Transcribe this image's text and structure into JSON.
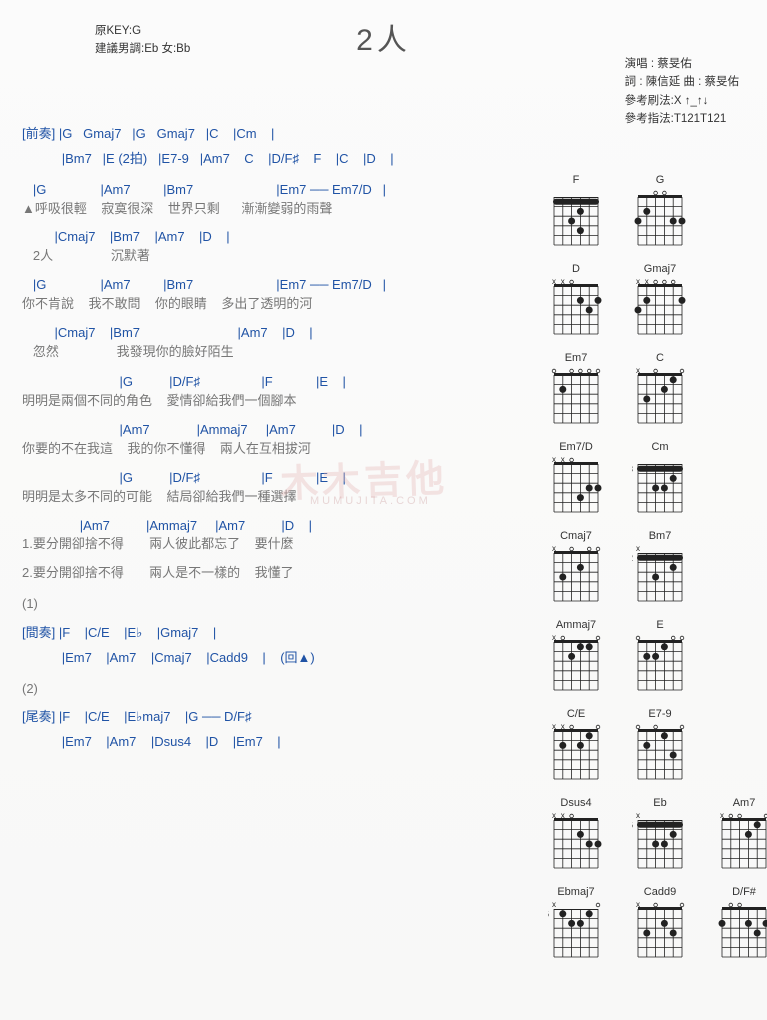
{
  "title": "2人",
  "meta_left": {
    "key_label": "原KEY:G",
    "suggest_label": "建議男調:Eb 女:Bb"
  },
  "meta_right": {
    "performer_label": "演唱 : ",
    "performer": "蔡旻佑",
    "lyricist_label": "詞 : ",
    "lyricist": "陳信延",
    "composer_label": "    曲 : ",
    "composer": "蔡旻佑",
    "strumming_label": "參考刷法:",
    "strumming": "X ↑_↑↓",
    "picking_label": "參考指法:",
    "picking": "T121T121"
  },
  "sections": {
    "intro": {
      "label": "[前奏]",
      "line1": "|G   Gmaj7   |G   Gmaj7   |C    |Cm    |",
      "line2": "|Bm7   |E (2拍)   |E7-9   |Am7    C    |D/F♯    F    |C    |D    |"
    },
    "verse1": {
      "c1": "   |G               |Am7         |Bm7                       |Em7 ── Em7/D   |",
      "l1": "▲呼吸很輕    寂寞很深    世界只剩      漸漸變弱的雨聲",
      "c2": "         |Cmaj7    |Bm7    |Am7    |D    |",
      "l2": "   2人                沉默著",
      "c3": "   |G               |Am7         |Bm7                       |Em7 ── Em7/D   |",
      "l3": "你不肯說    我不敢問    你的眼睛    多出了透明的河",
      "c4": "         |Cmaj7    |Bm7                           |Am7    |D    |",
      "l4": "   忽然                我發現你的臉好陌生"
    },
    "chorus": {
      "c1": "                           |G          |D/F♯                 |F            |E    |",
      "l1": "明明是兩個不同的角色    愛情卻給我們一個腳本",
      "c2": "                           |Am7             |Ammaj7     |Am7          |D    |",
      "l2": "你要的不在我這    我的你不懂得    兩人在互相拔河",
      "c3": "                           |G          |D/F♯                 |F            |E    |",
      "l3": "明明是太多不同的可能    結局卻給我們一種選擇",
      "c4": "                |Am7          |Ammaj7     |Am7          |D    |",
      "l4a": "1.要分開卻捨不得       兩人彼此都忘了    要什麼",
      "l4b": "2.要分開卻捨不得       兩人是不一樣的    我懂了"
    },
    "marker1": "(1)",
    "interlude": {
      "label": "[間奏]",
      "line1": "|F    |C/E    |E♭    |Gmaj7    |",
      "line2": "|Em7    |Am7    |Cmaj7    |Cadd9    |    (回▲)"
    },
    "marker2": "(2)",
    "outro": {
      "label": "[尾奏]",
      "line1": "|F    |C/E    |E♭maj7    |G ── D/F♯",
      "line2": "|Em7    |Am7    |Dsus4    |D    |Em7    |"
    }
  },
  "diagrams": [
    [
      {
        "name": "F",
        "barre": 1,
        "dots": [
          [
            2,
            3
          ],
          [
            3,
            2
          ],
          [
            3,
            4
          ]
        ]
      },
      {
        "name": "G",
        "dots": [
          [
            0,
            3
          ],
          [
            1,
            2
          ],
          [
            4,
            3
          ],
          [
            5,
            3
          ]
        ]
      }
    ],
    [
      {
        "name": "D",
        "mute": [
          0,
          1
        ],
        "dots": [
          [
            3,
            2
          ],
          [
            4,
            3
          ],
          [
            5,
            2
          ]
        ]
      },
      {
        "name": "Gmaj7",
        "mute": [
          0,
          1
        ],
        "dots": [
          [
            0,
            3
          ],
          [
            1,
            2
          ],
          [
            5,
            2
          ]
        ]
      }
    ],
    [
      {
        "name": "Em7",
        "dots": [
          [
            1,
            2
          ]
        ]
      },
      {
        "name": "C",
        "mute": [
          0
        ],
        "dots": [
          [
            1,
            3
          ],
          [
            3,
            2
          ],
          [
            4,
            1
          ]
        ]
      }
    ],
    [
      {
        "name": "Em7/D",
        "mute": [
          0,
          1
        ],
        "dots": [
          [
            3,
            4
          ],
          [
            4,
            3
          ],
          [
            5,
            3
          ]
        ]
      },
      {
        "name": "Cm",
        "barre": 3,
        "fretnum": "3",
        "dots": [
          [
            2,
            5
          ],
          [
            3,
            5
          ],
          [
            4,
            4
          ]
        ]
      }
    ],
    [
      {
        "name": "Cmaj7",
        "mute": [
          0
        ],
        "dots": [
          [
            1,
            3
          ],
          [
            3,
            2
          ]
        ]
      },
      {
        "name": "Bm7",
        "barre": 2,
        "mute": [
          0
        ],
        "fretnum": "2",
        "dots": [
          [
            2,
            4
          ],
          [
            4,
            3
          ]
        ]
      }
    ],
    [
      {
        "name": "Ammaj7",
        "mute": [
          0
        ],
        "dots": [
          [
            2,
            2
          ],
          [
            3,
            1
          ],
          [
            4,
            1
          ]
        ]
      },
      {
        "name": "E",
        "dots": [
          [
            1,
            2
          ],
          [
            2,
            2
          ],
          [
            3,
            1
          ]
        ]
      }
    ],
    [
      {
        "name": "C/E",
        "mute": [
          0,
          1
        ],
        "dots": [
          [
            1,
            2
          ],
          [
            3,
            2
          ],
          [
            4,
            1
          ]
        ]
      },
      {
        "name": "E7-9",
        "dots": [
          [
            1,
            2
          ],
          [
            3,
            1
          ],
          [
            4,
            3
          ]
        ]
      }
    ],
    [
      {
        "name": "Dsus4",
        "mute": [
          0,
          1
        ],
        "dots": [
          [
            3,
            2
          ],
          [
            4,
            3
          ],
          [
            5,
            3
          ]
        ]
      },
      {
        "name": "Eb",
        "barre": 6,
        "mute": [
          0
        ],
        "fretnum": "6",
        "dots": [
          [
            2,
            8
          ],
          [
            3,
            8
          ],
          [
            4,
            7
          ]
        ]
      },
      {
        "name": "Am7",
        "mute": [
          0
        ],
        "dots": [
          [
            3,
            2
          ],
          [
            4,
            1
          ]
        ]
      }
    ],
    [
      {
        "name": "Ebmaj7",
        "mute": [
          0
        ],
        "fretnum": "6",
        "dots": [
          [
            1,
            6
          ],
          [
            2,
            7
          ],
          [
            3,
            7
          ],
          [
            4,
            6
          ]
        ]
      },
      {
        "name": "Cadd9",
        "mute": [
          0
        ],
        "dots": [
          [
            1,
            3
          ],
          [
            3,
            2
          ],
          [
            4,
            3
          ]
        ]
      },
      {
        "name": "D/F#",
        "dots": [
          [
            0,
            2
          ],
          [
            3,
            2
          ],
          [
            4,
            3
          ],
          [
            5,
            2
          ]
        ]
      }
    ]
  ],
  "watermark": "木木吉他",
  "watermark_sub": "MUMUJITA.COM"
}
